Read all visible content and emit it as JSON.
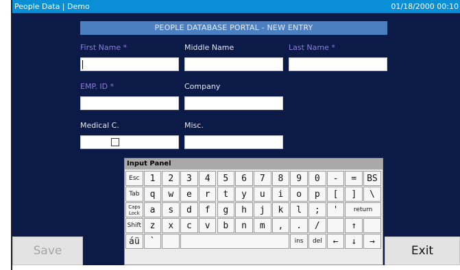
{
  "titlebar": {
    "app_title": "People Data | Demo",
    "datetime": "01/18/2000 00:10"
  },
  "form": {
    "heading": "PEOPLE DATABASE PORTAL - NEW ENTRY",
    "first_name": {
      "label": "First Name *",
      "value": ""
    },
    "middle_name": {
      "label": "Middle Name",
      "value": ""
    },
    "last_name": {
      "label": "Last Name *",
      "value": ""
    },
    "emp_id": {
      "label": "EMP. ID *",
      "value": ""
    },
    "company": {
      "label": "Company",
      "value": ""
    },
    "medical": {
      "label": "Medical C.",
      "checked": false
    },
    "misc": {
      "label": "Misc.",
      "value": ""
    }
  },
  "buttons": {
    "save": "Save",
    "exit": "Exit"
  },
  "keyboard": {
    "title": "Input Panel",
    "rows": [
      [
        "Esc",
        "1",
        "2",
        "3",
        "4",
        "5",
        "6",
        "7",
        "8",
        "9",
        "0",
        "-",
        "=",
        "BS"
      ],
      [
        "Tab",
        "q",
        "w",
        "e",
        "r",
        "t",
        "y",
        "u",
        "i",
        "o",
        "p",
        "[",
        "]",
        "\\"
      ],
      [
        "Caps Lock",
        "a",
        "s",
        "d",
        "f",
        "g",
        "h",
        "j",
        "k",
        "l",
        ";",
        "'",
        "return"
      ],
      [
        "Shift",
        "z",
        "x",
        "c",
        "v",
        "b",
        "n",
        "m",
        ",",
        ".",
        "/",
        "",
        "↑",
        ""
      ],
      [
        "áü",
        "`",
        "",
        "",
        "ins",
        "del",
        "←",
        "↓",
        "→"
      ]
    ]
  },
  "colors": {
    "titlebar": "#0a8fd6",
    "panel": "#0b1a47",
    "heading_bar": "#4c7fbf",
    "required_label": "#8c7ddc"
  }
}
